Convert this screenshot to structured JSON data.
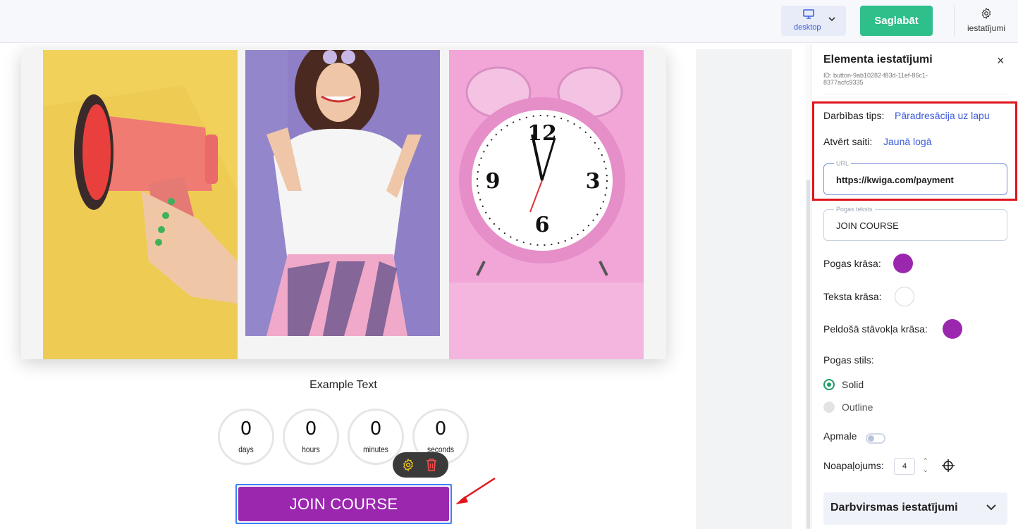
{
  "topbar": {
    "device_label": "desktop",
    "save_label": "Saglabāt",
    "settings_label": "iestatījumi"
  },
  "canvas": {
    "example_text": "Example Text",
    "countdown": [
      {
        "value": "0",
        "unit": "days"
      },
      {
        "value": "0",
        "unit": "hours"
      },
      {
        "value": "0",
        "unit": "minutes"
      },
      {
        "value": "0",
        "unit": "seconds"
      }
    ],
    "button_label": "JOIN COURSE",
    "button_color": "#9b27af"
  },
  "panel": {
    "title": "Elementa iestatījumi",
    "close_symbol": "×",
    "element_id": "ID: button-9ab10282-f83d-11ef-86c1-8377acfc9335",
    "action_type_label": "Darbības tips:",
    "action_type_value": "Pāradresācija uz lapu",
    "open_link_label": "Atvērt saiti:",
    "open_link_value": "Jaunā logā",
    "url_label": "URL",
    "url_value": "https://kwiga.com/payment",
    "button_text_label": "Pogas teksts",
    "button_text_value": "JOIN COURSE",
    "button_color_label": "Pogas krāsa:",
    "button_color": "#9b27af",
    "text_color_label": "Teksta krāsa:",
    "text_color": "#ffffff",
    "hover_color_label": "Peldošā stāvokļa krāsa:",
    "hover_color": "#9b27af",
    "button_style_label": "Pogas stils:",
    "style_options": [
      "Solid",
      "Outline"
    ],
    "style_selected": "Solid",
    "border_label": "Apmale",
    "border_enabled": false,
    "rounding_label": "Noapaļojums:",
    "rounding_value": "4",
    "section_title": "Darbvirsmas iestatījumi"
  },
  "icons": {
    "device": "monitor-icon",
    "settings": "gear-icon",
    "toolbar": [
      "gear-icon",
      "trash-icon"
    ],
    "arrow": "annotation-arrow-icon"
  },
  "colors": {
    "save_green": "#2ebf8a",
    "link_blue": "#3b5bdb",
    "highlight_red": "#e0141c"
  }
}
